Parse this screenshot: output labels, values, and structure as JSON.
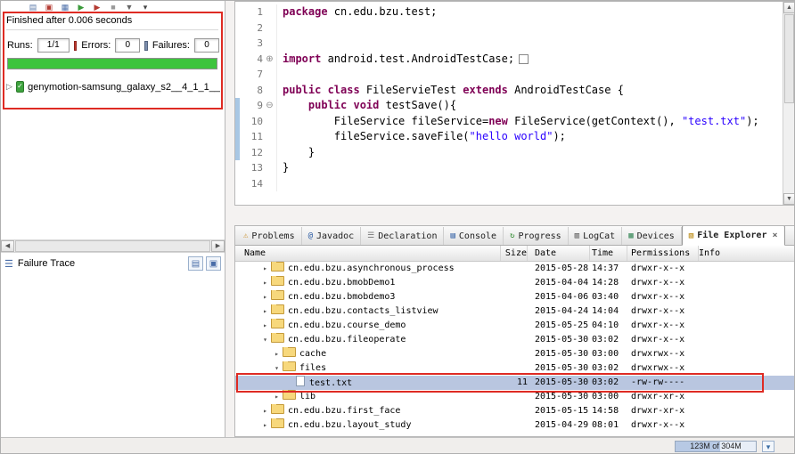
{
  "junit": {
    "toolbar_icons": [
      {
        "name": "hierarchy-icon",
        "glyph": "▤",
        "color": "#5a79a8"
      },
      {
        "name": "errors-filter-icon",
        "glyph": "▣",
        "color": "#b43b32"
      },
      {
        "name": "failures-filter-icon",
        "glyph": "▦",
        "color": "#4a6da8"
      },
      {
        "name": "rerun-test-icon",
        "glyph": "▶",
        "color": "#3a9a3a"
      },
      {
        "name": "rerun-failed-first-icon",
        "glyph": "▶",
        "color": "#b43b32"
      },
      {
        "name": "stop-icon",
        "glyph": "■",
        "color": "#999999"
      },
      {
        "name": "test-history-icon",
        "glyph": "▼",
        "color": "#666666"
      },
      {
        "name": "view-menu-icon",
        "glyph": "▾",
        "color": "#444444"
      }
    ],
    "finished_text": "Finished after 0.006 seconds",
    "runs_label": "Runs:",
    "runs_value": "1/1",
    "errors_label": "Errors:",
    "errors_value": "0",
    "failures_label": "Failures:",
    "failures_value": "0",
    "tree_expander": "▷",
    "suite_icon_glyph": "✓",
    "tree_item_label": "genymotion-samsung_galaxy_s2__4_1_1__",
    "failure_trace_label": "Failure Trace",
    "scroll_left": "◀",
    "scroll_right": "▶"
  },
  "editor": {
    "scroll_up": "▲",
    "scroll_down": "▼",
    "lines": [
      {
        "n": "1",
        "fold": "",
        "bar": false,
        "segs": [
          {
            "c": "kw",
            "t": "package"
          },
          {
            "c": "pl",
            "t": " cn.edu.bzu.test;"
          }
        ]
      },
      {
        "n": "2",
        "fold": "",
        "bar": false,
        "segs": []
      },
      {
        "n": "3",
        "fold": "",
        "bar": false,
        "segs": []
      },
      {
        "n": "4",
        "fold": "plus",
        "bar": false,
        "segs": [
          {
            "c": "kw",
            "t": "import"
          },
          {
            "c": "pl",
            "t": " android.test.AndroidTestCase;"
          },
          {
            "c": "foldbox",
            "t": ""
          }
        ]
      },
      {
        "n": "7",
        "fold": "",
        "bar": false,
        "segs": []
      },
      {
        "n": "8",
        "fold": "",
        "bar": false,
        "segs": [
          {
            "c": "kw",
            "t": "public class"
          },
          {
            "c": "pl",
            "t": " FileServieTest "
          },
          {
            "c": "kw",
            "t": "extends"
          },
          {
            "c": "pl",
            "t": " AndroidTestCase {"
          }
        ]
      },
      {
        "n": "9",
        "fold": "minus",
        "bar": true,
        "segs": [
          {
            "c": "pl",
            "t": "    "
          },
          {
            "c": "kw",
            "t": "public void"
          },
          {
            "c": "pl",
            "t": " testSave(){"
          }
        ]
      },
      {
        "n": "10",
        "fold": "",
        "bar": true,
        "segs": [
          {
            "c": "pl",
            "t": "        FileService fileService="
          },
          {
            "c": "kw",
            "t": "new"
          },
          {
            "c": "pl",
            "t": " FileService(getContext(), "
          },
          {
            "c": "str",
            "t": "\"test.txt\""
          },
          {
            "c": "pl",
            "t": ");"
          }
        ]
      },
      {
        "n": "11",
        "fold": "",
        "bar": true,
        "segs": [
          {
            "c": "pl",
            "t": "        fileService.saveFile("
          },
          {
            "c": "str",
            "t": "\"hello world\""
          },
          {
            "c": "pl",
            "t": ");"
          }
        ]
      },
      {
        "n": "12",
        "fold": "",
        "bar": true,
        "segs": [
          {
            "c": "pl",
            "t": "    }"
          }
        ]
      },
      {
        "n": "13",
        "fold": "",
        "bar": false,
        "segs": [
          {
            "c": "pl",
            "t": "}"
          }
        ]
      },
      {
        "n": "14",
        "fold": "",
        "bar": false,
        "segs": []
      }
    ]
  },
  "bottom_panel": {
    "tabs": [
      {
        "label": "Problems",
        "icon": "problems-icon",
        "glyph": "⚠",
        "color": "#c98a1b",
        "active": false
      },
      {
        "label": "Javadoc",
        "icon": "javadoc-icon",
        "glyph": "@",
        "color": "#2456a0",
        "active": false
      },
      {
        "label": "Declaration",
        "icon": "declaration-icon",
        "glyph": "☰",
        "color": "#777777",
        "active": false
      },
      {
        "label": "Console",
        "icon": "console-icon",
        "glyph": "▤",
        "color": "#2456a0",
        "active": false
      },
      {
        "label": "Progress",
        "icon": "progress-icon",
        "glyph": "↻",
        "color": "#2e8b2e",
        "active": false
      },
      {
        "label": "LogCat",
        "icon": "logcat-icon",
        "glyph": "▥",
        "color": "#555555",
        "active": false
      },
      {
        "label": "Devices",
        "icon": "devices-icon",
        "glyph": "▦",
        "color": "#3a8a5a",
        "active": false
      },
      {
        "label": "File Explorer",
        "icon": "file-explorer-icon",
        "glyph": "▧",
        "color": "#b8860b",
        "active": true,
        "close": "×"
      }
    ]
  },
  "file_explorer": {
    "headers": [
      "Name",
      "Size",
      "Date",
      "Time",
      "Permissions",
      "Info"
    ],
    "rows": [
      {
        "indent": 2,
        "expand": "collapsed",
        "type": "folder",
        "name": "cn.edu.bzu.asynchronous_process",
        "size": "",
        "date": "2015-05-28",
        "time": "14:37",
        "perm": "drwxr-x--x",
        "info": "",
        "selected": false
      },
      {
        "indent": 2,
        "expand": "collapsed",
        "type": "folder",
        "name": "cn.edu.bzu.bmobDemo1",
        "size": "",
        "date": "2015-04-04",
        "time": "14:28",
        "perm": "drwxr-x--x",
        "info": "",
        "selected": false
      },
      {
        "indent": 2,
        "expand": "collapsed",
        "type": "folder",
        "name": "cn.edu.bzu.bmobdemo3",
        "size": "",
        "date": "2015-04-06",
        "time": "03:40",
        "perm": "drwxr-x--x",
        "info": "",
        "selected": false
      },
      {
        "indent": 2,
        "expand": "collapsed",
        "type": "folder",
        "name": "cn.edu.bzu.contacts_listview",
        "size": "",
        "date": "2015-04-24",
        "time": "14:04",
        "perm": "drwxr-x--x",
        "info": "",
        "selected": false
      },
      {
        "indent": 2,
        "expand": "collapsed",
        "type": "folder",
        "name": "cn.edu.bzu.course_demo",
        "size": "",
        "date": "2015-05-25",
        "time": "04:10",
        "perm": "drwxr-x--x",
        "info": "",
        "selected": false
      },
      {
        "indent": 2,
        "expand": "expanded",
        "type": "folder",
        "name": "cn.edu.bzu.fileoperate",
        "size": "",
        "date": "2015-05-30",
        "time": "03:02",
        "perm": "drwxr-x--x",
        "info": "",
        "selected": false
      },
      {
        "indent": 3,
        "expand": "collapsed",
        "type": "folder",
        "name": "cache",
        "size": "",
        "date": "2015-05-30",
        "time": "03:00",
        "perm": "drwxrwx--x",
        "info": "",
        "selected": false
      },
      {
        "indent": 3,
        "expand": "expanded",
        "type": "folder",
        "name": "files",
        "size": "",
        "date": "2015-05-30",
        "time": "03:02",
        "perm": "drwxrwx--x",
        "info": "",
        "selected": false
      },
      {
        "indent": 4,
        "expand": "none",
        "type": "file",
        "name": "test.txt",
        "size": "11",
        "date": "2015-05-30",
        "time": "03:02",
        "perm": "-rw-rw----",
        "info": "",
        "selected": true
      },
      {
        "indent": 3,
        "expand": "collapsed",
        "type": "folder",
        "name": "lib",
        "size": "",
        "date": "2015-05-30",
        "time": "03:00",
        "perm": "drwxr-xr-x",
        "info": "",
        "selected": false
      },
      {
        "indent": 2,
        "expand": "collapsed",
        "type": "folder",
        "name": "cn.edu.bzu.first_face",
        "size": "",
        "date": "2015-05-15",
        "time": "14:58",
        "perm": "drwxr-xr-x",
        "info": "",
        "selected": false
      },
      {
        "indent": 2,
        "expand": "collapsed",
        "type": "folder",
        "name": "cn.edu.bzu.layout_study",
        "size": "",
        "date": "2015-04-29",
        "time": "08:01",
        "perm": "drwxr-x--x",
        "info": "",
        "selected": false
      }
    ]
  },
  "status": {
    "heap_text": "123M of 304M"
  }
}
